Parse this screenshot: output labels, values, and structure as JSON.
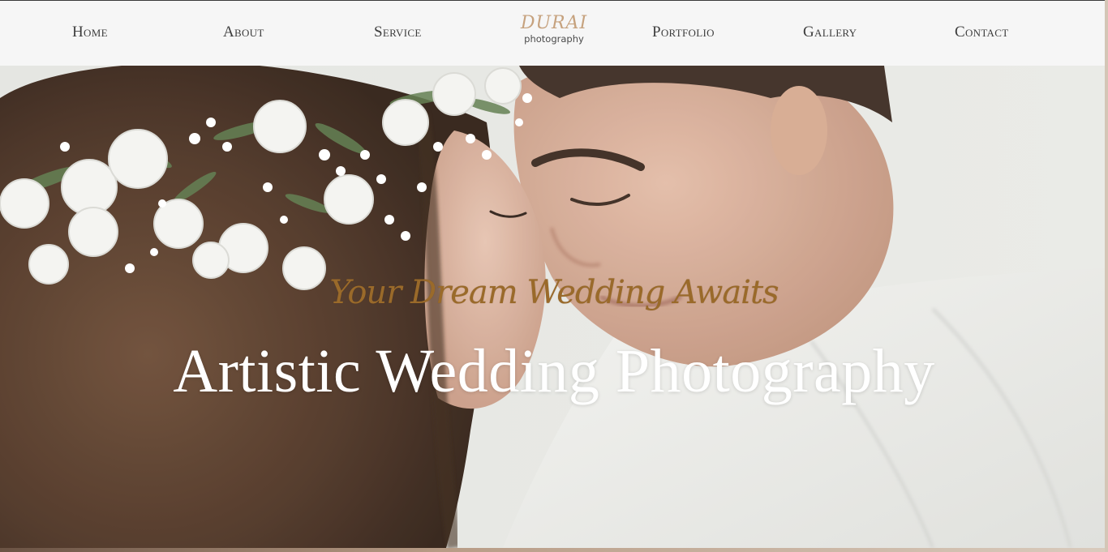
{
  "nav": {
    "items": [
      {
        "label": "Home"
      },
      {
        "label": "About"
      },
      {
        "label": "Service"
      },
      {
        "label": "Portfolio"
      },
      {
        "label": "Gallery"
      },
      {
        "label": "Contact"
      }
    ]
  },
  "logo": {
    "main": "DURAI",
    "sub": "photography"
  },
  "hero": {
    "tagline": "Your Dream Wedding Awaits",
    "headline": "Artistic Wedding Photography",
    "image_description": "couple-forehead-touch-flower-crown"
  },
  "colors": {
    "logo_accent": "#c6a27e",
    "tagline_gold": "#9a6a2a",
    "nav_bg": "#f6f6f6",
    "nav_text": "#3d3d3d",
    "headline_text": "#ffffff"
  }
}
